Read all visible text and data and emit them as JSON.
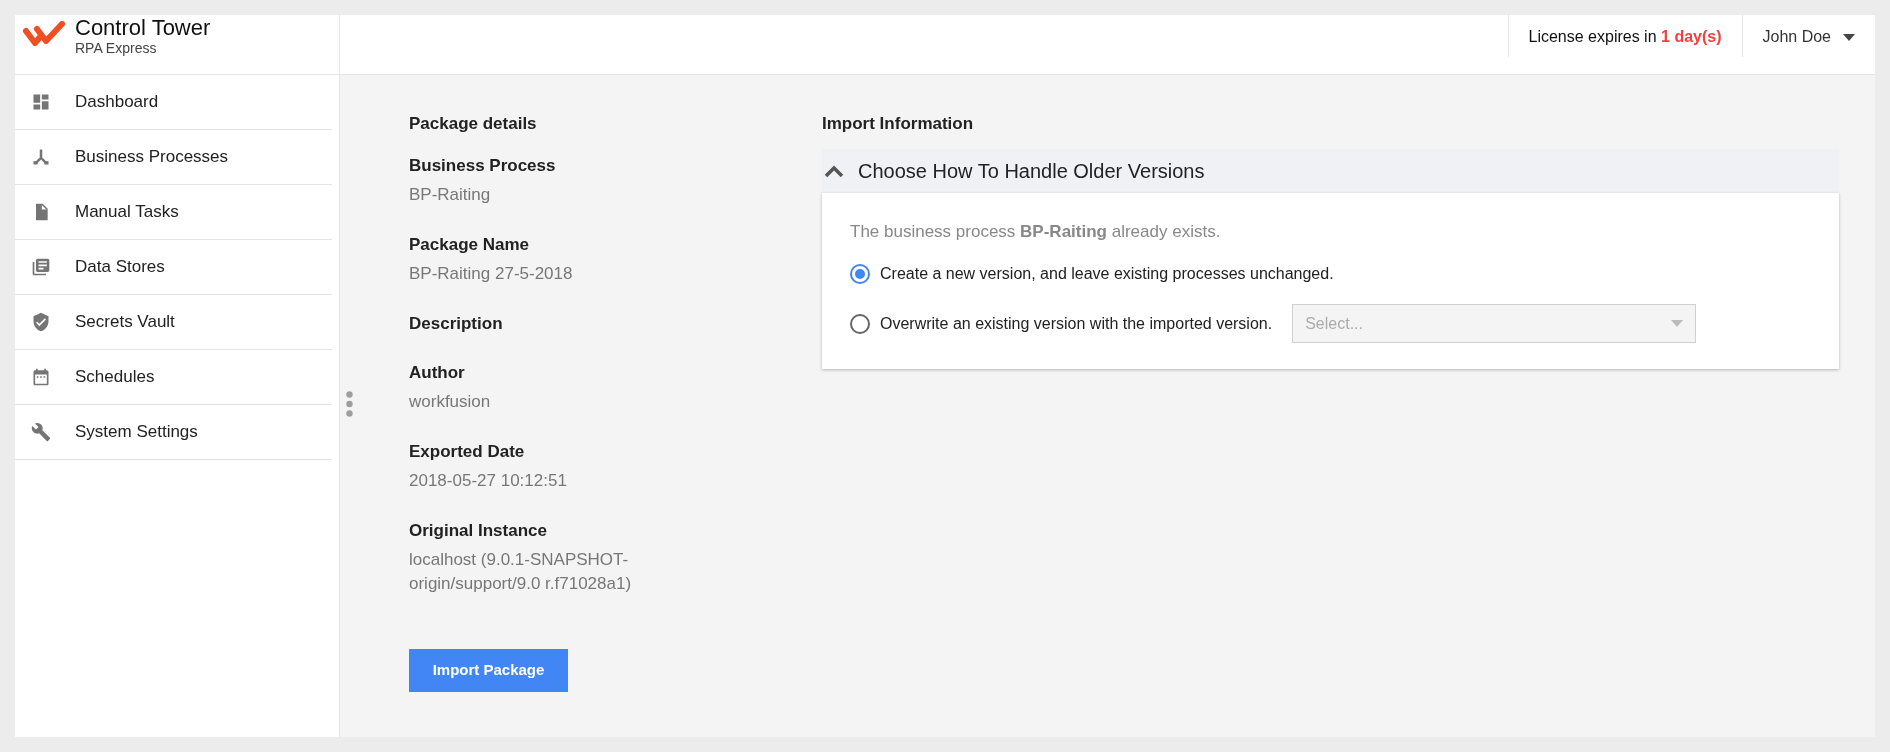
{
  "brand": {
    "title": "Control Tower",
    "subtitle": "RPA Express"
  },
  "header": {
    "license_text": "License expires in",
    "license_remaining": "1 day(s)",
    "user": "John Doe"
  },
  "sidebar": {
    "items": [
      {
        "label": "Dashboard",
        "kind": "dashboard"
      },
      {
        "label": "Business Processes",
        "kind": "processes"
      },
      {
        "label": "Manual Tasks",
        "kind": "file"
      },
      {
        "label": "Data Stores",
        "kind": "stores"
      },
      {
        "label": "Secrets Vault",
        "kind": "shield"
      },
      {
        "label": "Schedules",
        "kind": "calendar"
      },
      {
        "label": "System Settings",
        "kind": "wrench"
      }
    ]
  },
  "package_details": {
    "title": "Package details",
    "fields": [
      {
        "label": "Business Process",
        "value": "BP-Raiting"
      },
      {
        "label": "Package Name",
        "value": "BP-Raiting 27-5-2018"
      },
      {
        "label": "Description"
      },
      {
        "label": "Author",
        "value": "workfusion"
      },
      {
        "label": "Exported Date",
        "value": "2018-05-27 10:12:51"
      },
      {
        "label": "Original Instance",
        "value": "localhost (9.0.1-SNAPSHOT-origin/support/9.0 r.f71028a1)"
      }
    ],
    "button": "Import Package"
  },
  "import_information": {
    "title": "Import Information",
    "section": {
      "title": "Choose How To Handle Older Versions",
      "expanded": true,
      "message": "The business process **BP-Raiting** already exists.",
      "options": [
        {
          "label": "Create a new version, and leave existing processes unchanged.",
          "selected": true
        },
        {
          "label": "Overwrite an existing version with the imported version.",
          "selected": false,
          "select": {
            "placeholder": "Select...",
            "disabled": true
          }
        }
      ]
    }
  }
}
